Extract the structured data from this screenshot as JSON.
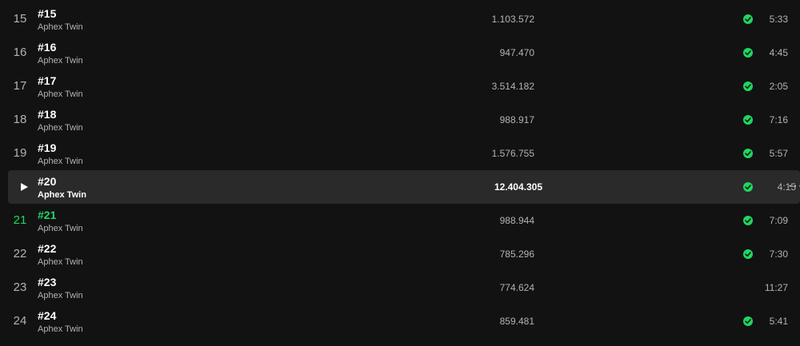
{
  "tracks": [
    {
      "number": "15",
      "title": "#15",
      "artist": "Aphex Twin",
      "plays": "1.103.572",
      "saved": true,
      "duration": "5:33"
    },
    {
      "number": "16",
      "title": "#16",
      "artist": "Aphex Twin",
      "plays": "947.470",
      "saved": true,
      "duration": "4:45"
    },
    {
      "number": "17",
      "title": "#17",
      "artist": "Aphex Twin",
      "plays": "3.514.182",
      "saved": true,
      "duration": "2:05"
    },
    {
      "number": "18",
      "title": "#18",
      "artist": "Aphex Twin",
      "plays": "988.917",
      "saved": true,
      "duration": "7:16"
    },
    {
      "number": "19",
      "title": "#19",
      "artist": "Aphex Twin",
      "plays": "1.576.755",
      "saved": true,
      "duration": "5:57"
    },
    {
      "number": "20",
      "title": "#20",
      "artist": "Aphex Twin",
      "plays": "12.404.305",
      "saved": true,
      "duration": "4:15",
      "hovered": true
    },
    {
      "number": "21",
      "title": "#21",
      "artist": "Aphex Twin",
      "plays": "988.944",
      "saved": true,
      "duration": "7:09",
      "playing": true
    },
    {
      "number": "22",
      "title": "#22",
      "artist": "Aphex Twin",
      "plays": "785.296",
      "saved": true,
      "duration": "7:30"
    },
    {
      "number": "23",
      "title": "#23",
      "artist": "Aphex Twin",
      "plays": "774.624",
      "saved": false,
      "duration": "11:27"
    },
    {
      "number": "24",
      "title": "#24",
      "artist": "Aphex Twin",
      "plays": "859.481",
      "saved": true,
      "duration": "5:41"
    }
  ],
  "more_options_glyph": "···",
  "colors": {
    "background": "#121212",
    "row_hover": "#2a2a2a",
    "accent_green": "#1ed760",
    "text_primary": "#ffffff",
    "text_secondary": "#b3b3b3"
  }
}
